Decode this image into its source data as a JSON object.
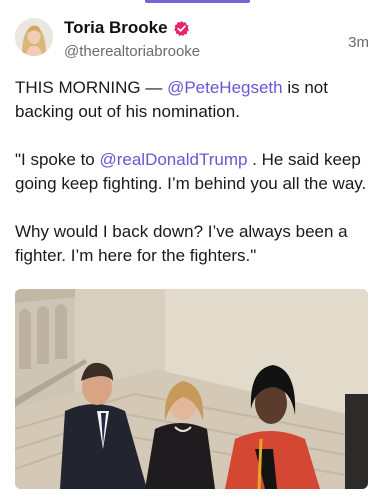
{
  "post": {
    "author_name": "Toria Brooke",
    "author_handle": "@therealtoriabrooke",
    "timestamp": "3m",
    "p1_pre": "THIS MORNING — ",
    "p1_mention": "@PeteHegseth",
    "p1_post": " is not backing out of his nomination.",
    "p2_pre": "\"I spoke to ",
    "p2_mention": "@realDonaldTrump",
    "p2_post": " . He said keep going keep fighting. I’m behind you all the way.",
    "p3": "Why would I back down? I’ve always been a fighter. I’m here for the fighters.\""
  },
  "colors": {
    "accent": "#6a55d8",
    "verified_badge": "#e8246b",
    "muted_text": "#6b6b6b"
  },
  "icons": {
    "verified": "verified-badge-icon"
  }
}
